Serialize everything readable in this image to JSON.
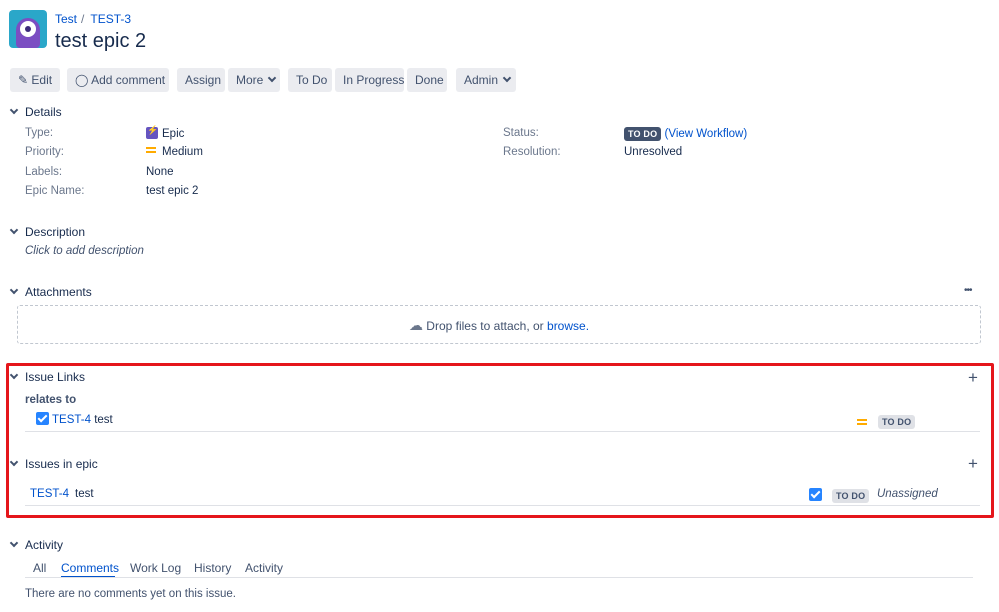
{
  "breadcrumb": {
    "project": "Test",
    "issue_key": "TEST-3"
  },
  "title": "test epic 2",
  "toolbar": {
    "edit": "Edit",
    "add_comment": "Add comment",
    "assign": "Assign",
    "more": "More",
    "todo": "To Do",
    "in_progress": "In Progress",
    "done": "Done",
    "admin": "Admin"
  },
  "details": {
    "heading": "Details",
    "type_label": "Type:",
    "type_value": "Epic",
    "priority_label": "Priority:",
    "priority_value": "Medium",
    "labels_label": "Labels:",
    "labels_value": "None",
    "epic_name_label": "Epic Name:",
    "epic_name_value": "test epic 2",
    "status_label": "Status:",
    "status_value": "TO DO",
    "workflow_link": "(View Workflow)",
    "resolution_label": "Resolution:",
    "resolution_value": "Unresolved"
  },
  "description": {
    "heading": "Description",
    "placeholder": "Click to add description"
  },
  "attachments": {
    "heading": "Attachments",
    "more": "•••",
    "drop_text": "Drop files to attach, or",
    "browse": "browse."
  },
  "issue_links": {
    "heading": "Issue Links",
    "relation": "relates to",
    "items": [
      {
        "key": "TEST-4",
        "summary": "test",
        "status": "TO DO"
      }
    ]
  },
  "issues_in_epic": {
    "heading": "Issues in epic",
    "items": [
      {
        "key": "TEST-4",
        "summary": "test",
        "status": "TO DO",
        "assignee": "Unassigned"
      }
    ]
  },
  "activity": {
    "heading": "Activity",
    "tabs": [
      "All",
      "Comments",
      "Work Log",
      "History",
      "Activity"
    ],
    "empty": "There are no comments yet on this issue."
  },
  "colors": {
    "highlight": "#e5161b",
    "link": "#0052cc",
    "accent": "#2684ff"
  }
}
